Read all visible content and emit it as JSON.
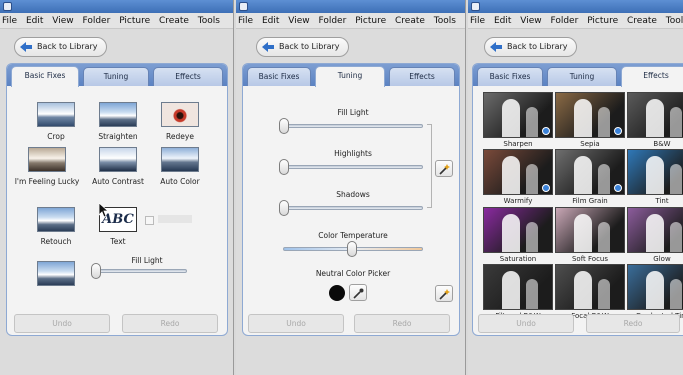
{
  "menu": [
    "File",
    "Edit",
    "View",
    "Folder",
    "Picture",
    "Create",
    "Tools"
  ],
  "back_label": "Back to Library",
  "tabs": [
    "Basic Fixes",
    "Tuning",
    "Effects"
  ],
  "basic_fixes": {
    "items": [
      "Crop",
      "Straighten",
      "Redeye",
      "I'm Feeling Lucky",
      "Auto Contrast",
      "Auto Color",
      "Retouch",
      "Text"
    ],
    "text_thumb": "ABC",
    "fill_light_label": "Fill Light",
    "undo": "Undo",
    "redo": "Redo"
  },
  "tuning": {
    "fill_light": "Fill Light",
    "highlights": "Highlights",
    "shadows": "Shadows",
    "color_temperature": "Color Temperature",
    "neutral_color_picker": "Neutral Color Picker",
    "undo": "Undo",
    "redo": "Redo",
    "levels": {
      "fill_light": 0.0,
      "highlights": 0.0,
      "shadows": 0.0,
      "color_temperature": 0.5
    }
  },
  "effects": {
    "items": [
      {
        "label": "Sharpen",
        "tint": "#6b6b6b"
      },
      {
        "label": "Sepia",
        "tint": "#8a6a45"
      },
      {
        "label": "B&W",
        "tint": "#5a5a5a"
      },
      {
        "label": "Warmify",
        "tint": "#7a4a3a"
      },
      {
        "label": "Film Grain",
        "tint": "#6e6e6e"
      },
      {
        "label": "Tint",
        "tint": "#2f78b8"
      },
      {
        "label": "Saturation",
        "tint": "#8a2aa0"
      },
      {
        "label": "Soft Focus",
        "tint": "#c9a7b6"
      },
      {
        "label": "Glow",
        "tint": "#8c5c9c"
      },
      {
        "label": "Filtered B&W",
        "tint": "#3a3a3a"
      },
      {
        "label": "Focal B&W",
        "tint": "#4e4e4e"
      },
      {
        "label": "Graduated Tint",
        "tint": "#3a6d9a"
      }
    ],
    "undo": "Undo",
    "redo": "Redo"
  },
  "colors": {
    "tab_strip": "#6d90ca",
    "title_bar": "#4a7cc4",
    "back_arrow": "#2f6fc8"
  }
}
